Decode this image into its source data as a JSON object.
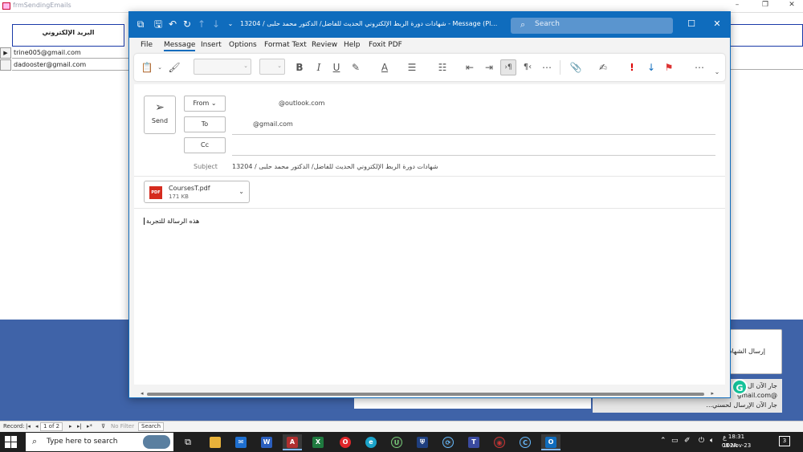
{
  "access": {
    "window_title": "frmSendingEmails",
    "column_header": "البريد الإلكتروني",
    "rows": [
      {
        "selector": "▶",
        "email": "trine005@gmail.com"
      },
      {
        "selector": "",
        "email": "dadooster@gmail.com"
      }
    ],
    "send_certificates_button": "إرسال الشهادات",
    "status_lines": [
      "جار الآن ال",
      "@gmail.com",
      "جار الآن الإرسال لحسني..."
    ],
    "record_nav": {
      "label": "Record:",
      "position": "1 of 2",
      "filter": "No Filter",
      "search": "Search"
    }
  },
  "outlook": {
    "title": "13204 / شهادات دورة الربط الإلكتروني الحديث للفاضل/ الدكتور محمد حلبى - Message (Plain T...",
    "search_placeholder": "Search",
    "tabs": [
      "File",
      "Message",
      "Insert",
      "Options",
      "Format Text",
      "Review",
      "Help",
      "Foxit PDF"
    ],
    "active_tab": "Message",
    "send_label": "Send",
    "from_label": "From",
    "from_value": "@outlook.com",
    "to_label": "To",
    "to_value": "@gmail.com",
    "cc_label": "Cc",
    "cc_value": "",
    "subject_label": "Subject",
    "subject_value": "13204 / شهادات دورة الربط الإلكتروني الحديث للفاضل/ الدكتور محمد حلبى",
    "attachment": {
      "name": "CoursesT.pdf",
      "size": "171 KB",
      "icon_text": "PDF"
    },
    "body": "هذه الرسالة للتجربة"
  },
  "taskbar": {
    "search_placeholder": "Type here to search",
    "time": "18:31",
    "date": "08-Nov-23",
    "lang": "ع",
    "tray_temp": "102A",
    "notification_count": "3"
  },
  "colors": {
    "outlook_blue": "#0f6cbd",
    "access_panel_blue": "#3f63a8",
    "taskbar": "#1f1f1f"
  }
}
